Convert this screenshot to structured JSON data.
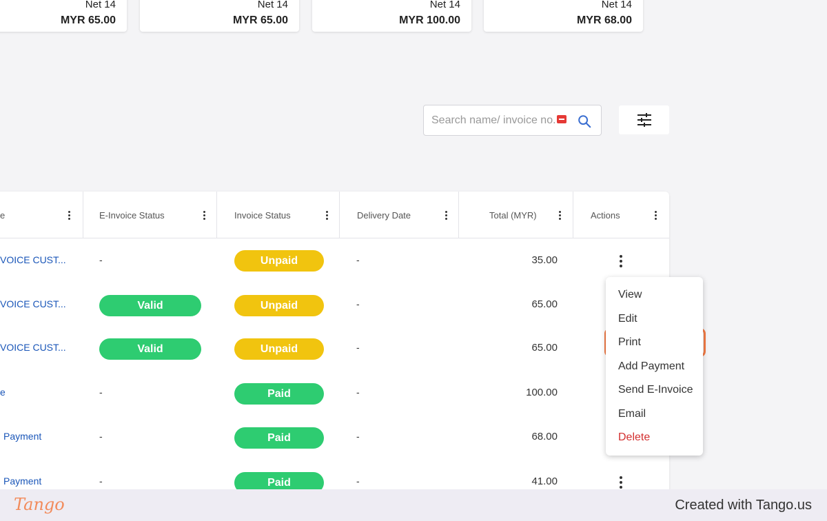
{
  "cards": [
    {
      "term": "Net 14",
      "amount": "MYR 65.00"
    },
    {
      "term": "Net 14",
      "amount": "MYR 65.00"
    },
    {
      "term": "Net 14",
      "amount": "MYR 100.00"
    },
    {
      "term": "Net 14",
      "amount": "MYR 68.00"
    }
  ],
  "search": {
    "placeholder": "Search name/ invoice no."
  },
  "table": {
    "headers": [
      "e",
      "E-Invoice Status",
      "Invoice Status",
      "Delivery Date",
      "Total (MYR)",
      "Actions"
    ],
    "rows": [
      {
        "name": "VOICE CUST...",
        "einvoice": "-",
        "status": "Unpaid",
        "delivery": "-",
        "total": "35.00"
      },
      {
        "name": "VOICE CUST...",
        "einvoice": "Valid",
        "status": "Unpaid",
        "delivery": "-",
        "total": "65.00"
      },
      {
        "name": "VOICE CUST...",
        "einvoice": "Valid",
        "status": "Unpaid",
        "delivery": "-",
        "total": "65.00"
      },
      {
        "name": "e",
        "einvoice": "-",
        "status": "Paid",
        "delivery": "-",
        "total": "100.00"
      },
      {
        "name": "Payment",
        "einvoice": "-",
        "status": "Paid",
        "delivery": "-",
        "total": "68.00"
      },
      {
        "name": "Payment",
        "einvoice": "-",
        "status": "Paid",
        "delivery": "-",
        "total": "41.00"
      }
    ]
  },
  "menu": {
    "items": [
      "View",
      "Edit",
      "Print",
      "Add Payment",
      "Send E-Invoice",
      "Email",
      "Delete"
    ],
    "highlighted": "Print"
  },
  "footer": {
    "logo": "Tango",
    "text": "Created with Tango.us"
  },
  "colors": {
    "valid": "#2ecc71",
    "paid": "#2ecc71",
    "unpaid": "#f1c40f",
    "link": "#1a56b8",
    "delete": "#d32f2f",
    "highlight": "#f47b45"
  }
}
